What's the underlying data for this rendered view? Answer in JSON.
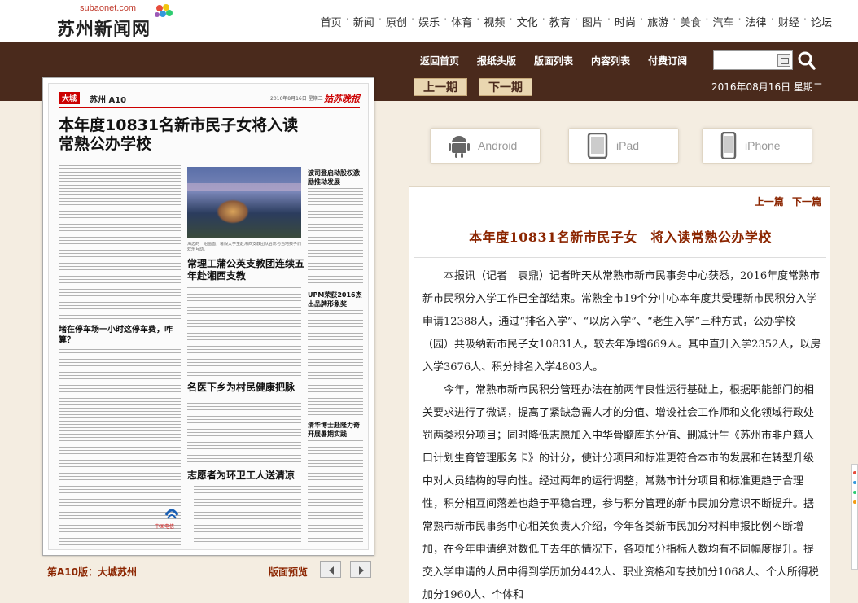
{
  "site": {
    "domain": "subaonet.com",
    "name": "苏州新闻网"
  },
  "top_nav": [
    "首页",
    "新闻",
    "原创",
    "娱乐",
    "体育",
    "视频",
    "文化",
    "教育",
    "图片",
    "时尚",
    "旅游",
    "美食",
    "汽车",
    "法律",
    "财经",
    "论坛"
  ],
  "paper_nav": {
    "items": [
      "返回首页",
      "报纸头版",
      "版面列表",
      "内容列表",
      "付费订阅"
    ],
    "search_value": "",
    "prev_issue": "上一期",
    "next_issue": "下一期",
    "date": "2016年08月16日  星期二"
  },
  "paper_page": {
    "section_tag": "大城",
    "page_name": "苏州 A10",
    "masthead_date": "2016年8月16日 星期二",
    "brand": "姑苏晚报",
    "headline": "本年度10831名新市民子女将入读常熟公办学校",
    "sub_headlines": [
      "波司登启动股权激励推动发展",
      "常理工蒲公英支教团连续五年赴湘西支教",
      "UPM荣获2016杰出品牌形象奖",
      "堵在停车场一小时这停车费，咋算？",
      "名医下乡为村民健康把脉",
      "清华博士赴隆力奇开展暑期实践",
      "志愿者为环卫工人送清凉"
    ],
    "photo_caption": "海边的一组画面，暑假大学生赴湘西支教团队合影与当地孩子们欢乐互动。",
    "logo_text": "中国电信"
  },
  "pager": {
    "current_page": "第A10版：大城苏州",
    "preview_label": "版面预览"
  },
  "apps": [
    {
      "label": "Android",
      "icon": "android-icon"
    },
    {
      "label": "iPad",
      "icon": "ipad-icon"
    },
    {
      "label": "iPhone",
      "icon": "iphone-icon"
    }
  ],
  "article": {
    "prev": "上一篇",
    "next": "下一篇",
    "title": "本年度10831名新市民子女　将入读常熟公办学校",
    "paragraphs": [
      "本报讯（记者　袁鼎）记者昨天从常熟市新市民事务中心获悉，2016年度常熟市新市民积分入学工作已全部结束。常熟全市19个分中心本年度共受理新市民积分入学申请12388人，通过“排名入学”、“以房入学”、“老生入学”三种方式，公办学校（园）共吸纳新市民子女10831人，较去年净增669人。其中直升入学2352人，以房入学3676人、积分排名入学4803人。",
      "今年，常熟市新市民积分管理办法在前两年良性运行基础上，根据职能部门的相关要求进行了微调，提高了紧缺急需人才的分值、增设社会工作师和文化领域行政处罚两类积分项目；同时降低志愿加入中华骨髓库的分值、删减计生《苏州市非户籍人口计划生育管理服务卡》的计分，使计分项目和标准更符合本市的发展和在转型升级中对人员结构的导向性。经过两年的运行调整，常熟市计分项目和标准更趋于合理性，积分相互间落差也趋于平稳合理，参与积分管理的新市民加分意识不断提升。据常熟市新市民事务中心相关负责人介绍，今年各类新市民加分材料申报比例不断增加，在今年申请绝对数低于去年的情况下，各项加分指标人数均有不同幅度提升。提交入学申请的人员中得到学历加分442人、职业资格和专技加分1068人、个人所得税加分1960人、个体和"
    ]
  },
  "colors": {
    "band": "#4a2a1c",
    "accent": "#8b2500",
    "background": "#f4ede1"
  }
}
